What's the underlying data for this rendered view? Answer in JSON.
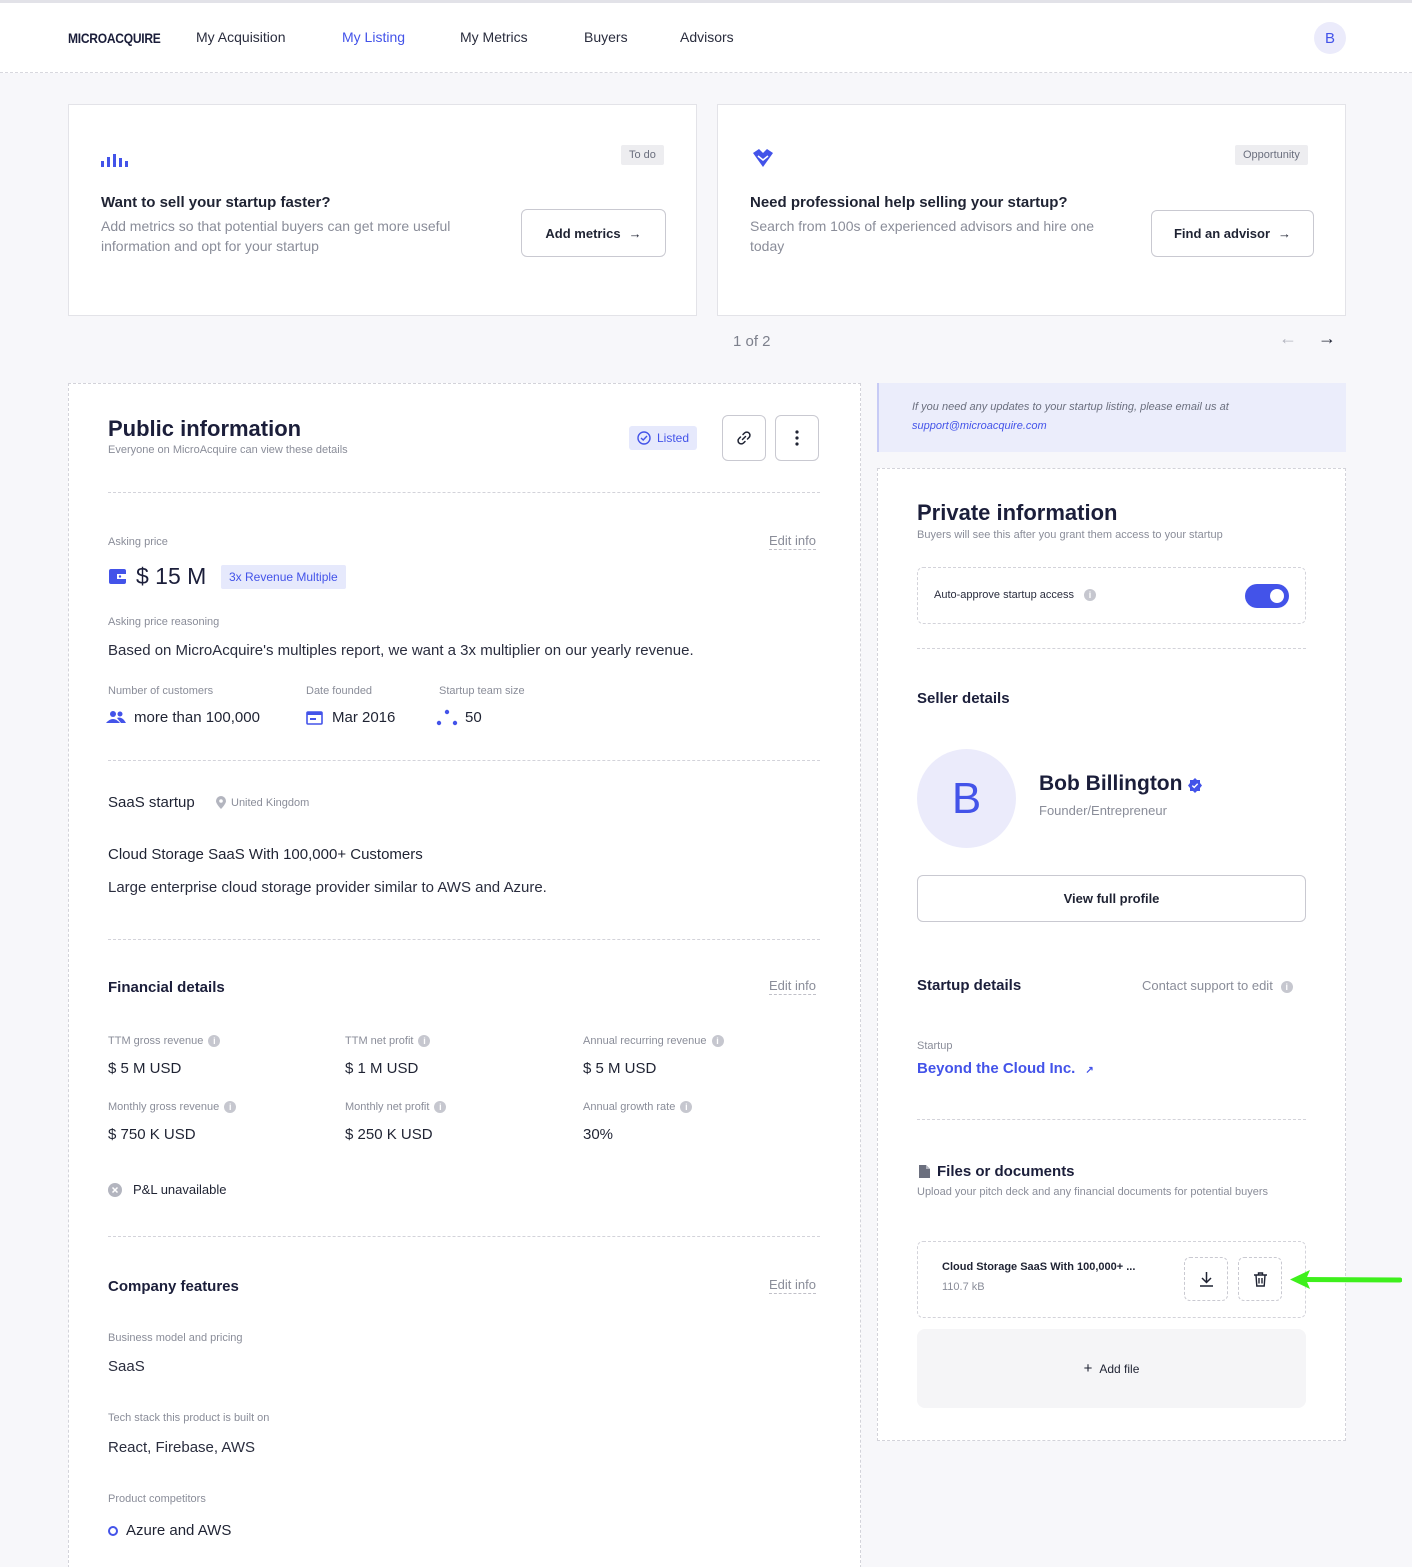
{
  "header": {
    "logo": "MICROACQUIRE",
    "nav": [
      "My Acquisition",
      "My Listing",
      "My Metrics",
      "Buyers",
      "Advisors"
    ],
    "active_nav": "My Listing",
    "avatar": "B"
  },
  "promos": [
    {
      "tag": "To do",
      "title": "Want to sell your startup faster?",
      "text": "Add metrics so that potential buyers can get more useful information and opt for your startup",
      "button": "Add metrics",
      "icon": "bar-chart-icon"
    },
    {
      "tag": "Opportunity",
      "title": "Need professional help selling your startup?",
      "text": "Search from 100s of experienced advisors and hire one today",
      "button": "Find an advisor",
      "icon": "handshake-icon"
    }
  ],
  "pager": "1 of 2",
  "public": {
    "title": "Public information",
    "subtitle": "Everyone on MicroAcquire can view these details",
    "status": "Listed",
    "edit_label": "Edit info",
    "asking_price_label": "Asking price",
    "asking_price": "$ 15 M",
    "multiple_badge": "3x Revenue Multiple",
    "reasoning_label": "Asking price reasoning",
    "reasoning": "Based on MicroAcquire's multiples report, we want a 3x multiplier on our yearly revenue.",
    "customers_label": "Number of customers",
    "customers": "more than 100,000",
    "founded_label": "Date founded",
    "founded": "Mar 2016",
    "team_label": "Startup team size",
    "team": "50",
    "type": "SaaS startup",
    "location": "United Kingdom",
    "headline": "Cloud Storage SaaS With 100,000+ Customers",
    "description": "Large enterprise cloud storage provider similar to AWS and Azure.",
    "financial": {
      "title": "Financial details",
      "items": [
        {
          "label": "TTM gross revenue",
          "value": "$ 5 M USD"
        },
        {
          "label": "TTM net profit",
          "value": "$ 1 M USD"
        },
        {
          "label": "Annual recurring revenue",
          "value": "$ 5 M USD"
        },
        {
          "label": "Monthly gross revenue",
          "value": "$ 750 K USD"
        },
        {
          "label": "Monthly net profit",
          "value": "$ 250 K USD"
        },
        {
          "label": "Annual growth rate",
          "value": "30%"
        }
      ],
      "pl": "P&L unavailable"
    },
    "features": {
      "title": "Company features",
      "business_label": "Business model and pricing",
      "business": "SaaS",
      "tech_label": "Tech stack this product is built on",
      "tech": "React, Firebase, AWS",
      "competitors_label": "Product competitors",
      "competitors": "Azure and AWS"
    }
  },
  "notice": {
    "text": "If you need any updates to your startup listing, please email us at",
    "email": "support@microacquire.com"
  },
  "private": {
    "title": "Private information",
    "subtitle": "Buyers will see this after you grant them access to your startup",
    "auto_approve": "Auto-approve startup access",
    "auto_approve_on": true,
    "seller_title": "Seller details",
    "seller_initial": "B",
    "seller_name": "Bob Billington",
    "seller_role": "Founder/Entrepreneur",
    "view_profile": "View full profile",
    "startup_title": "Startup details",
    "contact_support": "Contact support to edit",
    "startup_label": "Startup",
    "startup_name": "Beyond the Cloud Inc.",
    "files_title": "Files or documents",
    "files_subtitle": "Upload your pitch deck and any financial documents for potential buyers",
    "file_name": "Cloud Storage SaaS With 100,000+ ...",
    "file_size": "110.7 kB",
    "add_file": "Add file"
  },
  "colors": {
    "accent": "#4353e9",
    "annotation_arrow": "#3ef01c",
    "badge_bg": "#e6e9fc"
  }
}
